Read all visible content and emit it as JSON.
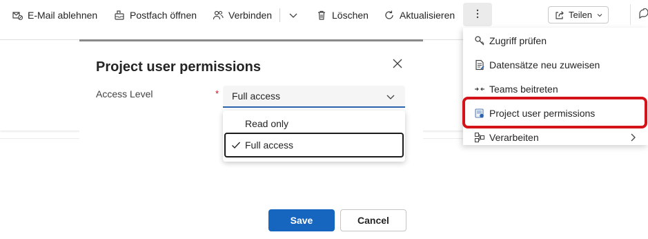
{
  "toolbar": {
    "reject_email_label": "E-Mail ablehnen",
    "open_mailbox_label": "Postfach öffnen",
    "connect_label": "Verbinden",
    "delete_label": "Löschen",
    "refresh_label": "Aktualisieren",
    "share_label": "Teilen"
  },
  "dialog": {
    "title": "Project user permissions",
    "field_label": "Access Level",
    "required_marker": "*",
    "selected_value": "Full access",
    "options": [
      "Read only",
      "Full access"
    ],
    "save_label": "Save",
    "cancel_label": "Cancel"
  },
  "overflow_menu": {
    "items": [
      {
        "label": "Zugriff prüfen",
        "icon": "check-access-icon"
      },
      {
        "label": "Datensätze neu zuweisen",
        "icon": "reassign-icon"
      },
      {
        "label": "Teams beitreten",
        "icon": "join-teams-icon"
      },
      {
        "label": "Project user permissions",
        "icon": "permissions-icon"
      },
      {
        "label": "Verarbeiten",
        "icon": "process-icon"
      }
    ]
  },
  "colors": {
    "primary": "#1666c0",
    "highlight": "#d4121a",
    "required": "#c50f1f"
  }
}
